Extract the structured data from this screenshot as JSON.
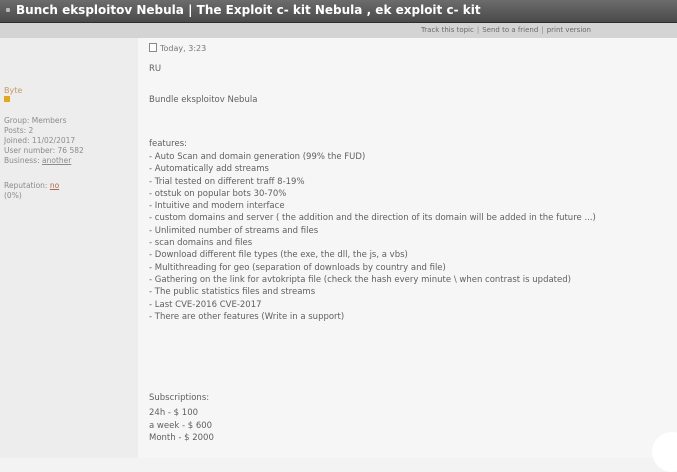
{
  "topic_title": "Bunch eksploitov Nebula | The Exploit c- kit Nebula , ek exploit c- kit",
  "toolbar": {
    "track": "Track this topic",
    "send": "Send to a friend",
    "print": "print version",
    "separator": "|"
  },
  "author": {
    "username": "Byte",
    "group": "Group: Members",
    "posts": "Posts: 2",
    "joined": "Joined: 11/02/2017",
    "user_number": "User number: 76 582",
    "business_label": "Business:",
    "business_value": "another",
    "reputation_label": "Reputation:",
    "reputation_value": "no",
    "reputation_percent": "(0%)",
    "rank_color": "#e8a717"
  },
  "post": {
    "date": "Today, 3:23",
    "lang": "RU",
    "subject": "Bundle eksploitov Nebula",
    "features_heading": "features:",
    "features": [
      "- Auto Scan and domain generation (99% the FUD)",
      "- Automatically add streams",
      "- Trial tested on different traff 8-19%",
      "- otstuk on popular bots 30-70%",
      "- Intuitive and modern interface",
      "- custom domains and server ( the addition and the direction of its domain will be added in the future ...)",
      "- Unlimited number of streams and files",
      "- scan domains and files",
      "- Download different file types (the exe, the dll, the js, a vbs)",
      "- Multithreading for geo (separation of downloads by country and file)",
      "- Gathering on the link for avtokripta file (check the hash every minute \\ when contrast is updated)",
      "- The public statistics files and streams",
      "- Last CVE-2016 CVE-2017",
      "- There are other features (Write in a support)"
    ],
    "subscriptions_heading": "Subscriptions:",
    "subscriptions": [
      "24h - $ 100",
      "a week - $ 600",
      "Month - $ 2000"
    ]
  }
}
